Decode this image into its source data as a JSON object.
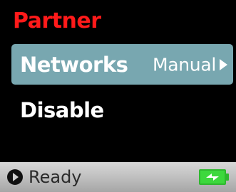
{
  "header": {
    "title": "Partner"
  },
  "menu": {
    "items": [
      {
        "label": "Networks",
        "value": "Manual",
        "selected": true
      },
      {
        "label": "Disable",
        "value": "",
        "selected": false
      }
    ]
  },
  "status": {
    "icon": "play-circle-icon",
    "text": "Ready",
    "battery_icon": "battery-charging-icon",
    "battery_color": "#3dd83d"
  },
  "colors": {
    "title": "#ff1a1a",
    "selected_item_bg": "#78a7b0",
    "background": "#000000"
  }
}
